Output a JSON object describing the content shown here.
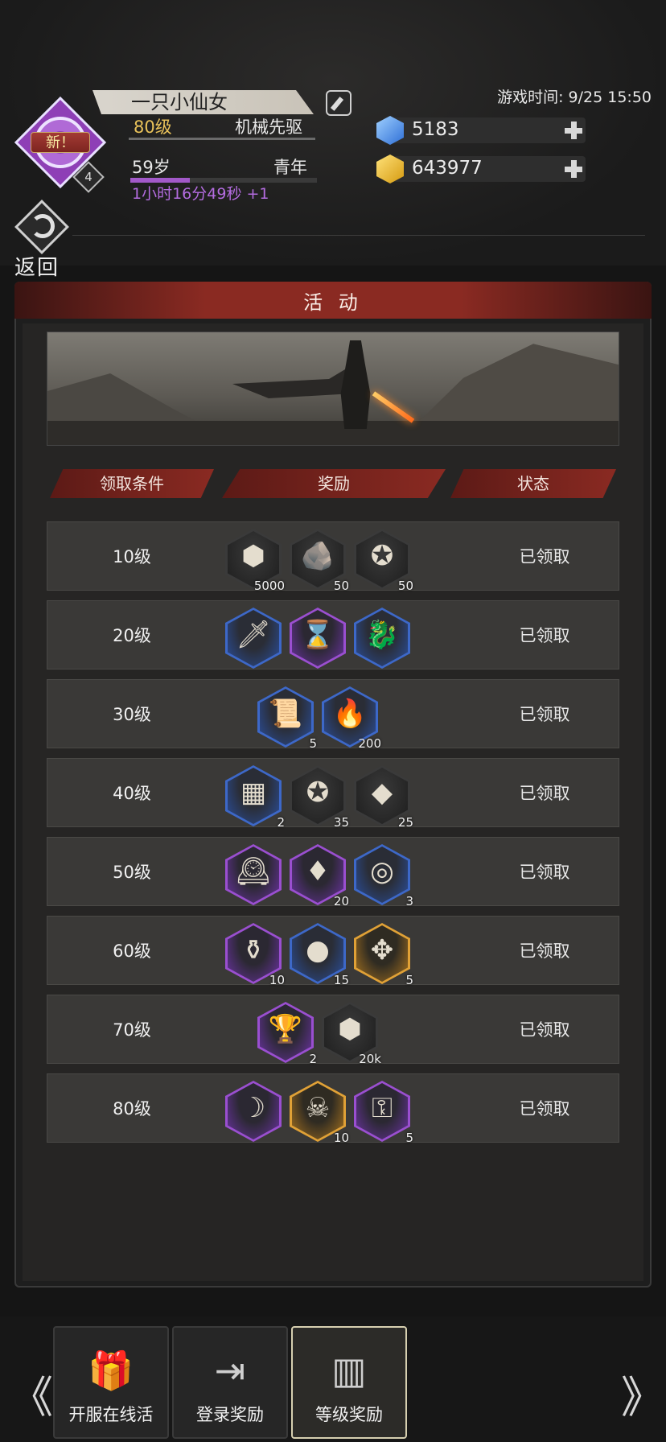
{
  "player": {
    "name": "一只小仙女",
    "new_tag": "新！",
    "badge_level": "4",
    "level": "80级",
    "class_name": "机械先驱",
    "age": "59岁",
    "stage": "青年",
    "age_progress": 0.32,
    "timer": "1小时16分49秒 +1"
  },
  "game_time": "游戏时间: 9/25 15:50",
  "currency": {
    "diamond": "5183",
    "gold": "643977"
  },
  "back_label": "返回",
  "panel": {
    "title": "活 动",
    "columns": [
      "领取条件",
      "奖励",
      "状态"
    ]
  },
  "rows": [
    {
      "cond": "10级",
      "status": "已领取",
      "items": [
        {
          "icon": "gold-gem-icon",
          "glyph": "⬢",
          "rarity": "r-none",
          "qty": "5000"
        },
        {
          "icon": "stone-icon",
          "glyph": "🪨",
          "rarity": "r-none",
          "qty": "50"
        },
        {
          "icon": "star-coin-icon",
          "glyph": "✪",
          "rarity": "r-none",
          "qty": "50"
        }
      ]
    },
    {
      "cond": "20级",
      "status": "已领取",
      "items": [
        {
          "icon": "sword-icon",
          "glyph": "🗡",
          "rarity": "r-blue",
          "qty": ""
        },
        {
          "icon": "hourglass-icon",
          "glyph": "⌛",
          "rarity": "r-purple",
          "qty": ""
        },
        {
          "icon": "dragon-icon",
          "glyph": "🐉",
          "rarity": "r-blue",
          "qty": ""
        }
      ]
    },
    {
      "cond": "30级",
      "status": "已领取",
      "items": [
        {
          "icon": "scroll-icon",
          "glyph": "📜",
          "rarity": "r-blue",
          "qty": "5"
        },
        {
          "icon": "torch-icon",
          "glyph": "🔥",
          "rarity": "r-blue",
          "qty": "200"
        }
      ]
    },
    {
      "cond": "40级",
      "status": "已领取",
      "items": [
        {
          "icon": "rune-tablet-icon",
          "glyph": "▦",
          "rarity": "r-blue",
          "qty": "2"
        },
        {
          "icon": "star-coin-icon",
          "glyph": "✪",
          "rarity": "r-none",
          "qty": "35"
        },
        {
          "icon": "crystal-icon",
          "glyph": "◆",
          "rarity": "r-none",
          "qty": "25"
        }
      ]
    },
    {
      "cond": "50级",
      "status": "已领取",
      "items": [
        {
          "icon": "clock-tower-icon",
          "glyph": "🕰",
          "rarity": "r-purple",
          "qty": ""
        },
        {
          "icon": "crystal-cluster-icon",
          "glyph": "♦",
          "rarity": "r-purple",
          "qty": "20"
        },
        {
          "icon": "pocket-watch-icon",
          "glyph": "◎",
          "rarity": "r-blue",
          "qty": "3"
        }
      ]
    },
    {
      "cond": "60级",
      "status": "已领取",
      "items": [
        {
          "icon": "potion-bottle-icon",
          "glyph": "⚱",
          "rarity": "r-purple",
          "qty": "10"
        },
        {
          "icon": "ore-icon",
          "glyph": "●",
          "rarity": "r-blue",
          "qty": "15"
        },
        {
          "icon": "compass-medal-icon",
          "glyph": "✥",
          "rarity": "r-gold",
          "qty": "5"
        }
      ]
    },
    {
      "cond": "70级",
      "status": "已领取",
      "items": [
        {
          "icon": "chalice-icon",
          "glyph": "🏆",
          "rarity": "r-purple",
          "qty": "2"
        },
        {
          "icon": "gold-gem-icon",
          "glyph": "⬢",
          "rarity": "r-none",
          "qty": "20k"
        }
      ]
    },
    {
      "cond": "80级",
      "status": "已领取",
      "items": [
        {
          "icon": "scythe-icon",
          "glyph": "☽",
          "rarity": "r-purple",
          "qty": ""
        },
        {
          "icon": "skull-crossbones-icon",
          "glyph": "☠",
          "rarity": "r-gold",
          "qty": "10"
        },
        {
          "icon": "key-icon",
          "glyph": "⚿",
          "rarity": "r-purple",
          "qty": "5"
        }
      ]
    }
  ],
  "tabs": [
    {
      "label": "开服在线活",
      "icon": "gift-icon",
      "glyph": "🎁"
    },
    {
      "label": "登录奖励",
      "icon": "login-icon",
      "glyph": "⇥"
    },
    {
      "label": "等级奖励",
      "icon": "bar-chart-icon",
      "glyph": "▥"
    }
  ],
  "nav": {
    "left": "《",
    "right": "》"
  }
}
